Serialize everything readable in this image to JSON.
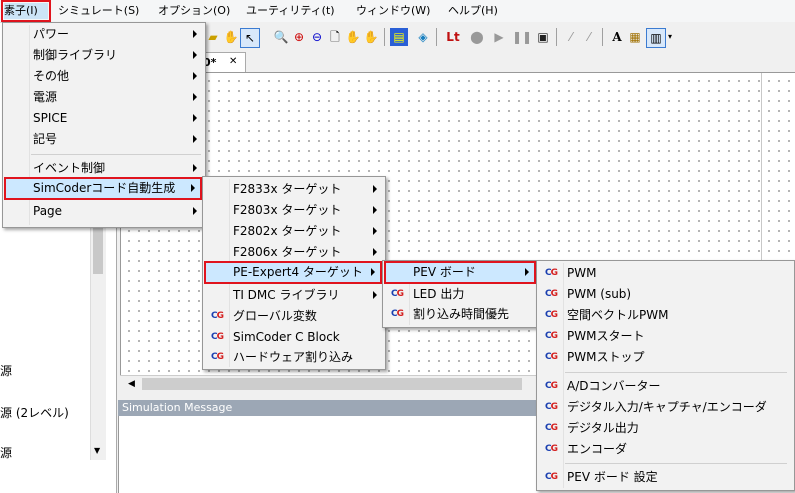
{
  "menubar": [
    "素子(I)",
    "シミュレート(S)",
    "オプション(O)",
    "ユーティリティ(t)",
    "ウィンドウ(W)",
    "ヘルプ(H)"
  ],
  "toolbar": {
    "lt_label": "Lt",
    "text_tool": "A"
  },
  "tab": {
    "label": "0*",
    "close": "✕"
  },
  "left_panel": [
    "源",
    "源 (2レベル)",
    "源"
  ],
  "sim_message": {
    "title": "Simulation Message"
  },
  "menu1": {
    "items": [
      {
        "label": "パワー"
      },
      {
        "label": "制御ライブラリ"
      },
      {
        "label": "その他"
      },
      {
        "label": "電源"
      },
      {
        "label": "SPICE"
      },
      {
        "label": "記号"
      },
      {
        "label": "イベント制御"
      },
      {
        "label": "SimCoderコード自動生成"
      },
      {
        "label": "Page"
      }
    ]
  },
  "menu2": {
    "items": [
      {
        "label": "F2833x ターゲット"
      },
      {
        "label": "F2803x ターゲット"
      },
      {
        "label": "F2802x ターゲット"
      },
      {
        "label": "F2806x ターゲット"
      },
      {
        "label": "PE-Expert4 ターゲット"
      },
      {
        "label": "TI DMC ライブラリ"
      },
      {
        "label": "グローバル変数"
      },
      {
        "label": "SimCoder C Block"
      },
      {
        "label": "ハードウェア割り込み"
      }
    ]
  },
  "menu3": {
    "items": [
      {
        "label": "PEV ボード"
      },
      {
        "label": "LED 出力"
      },
      {
        "label": "割り込み時間優先"
      }
    ]
  },
  "menu4": {
    "items": [
      {
        "label": "PWM"
      },
      {
        "label": "PWM (sub)"
      },
      {
        "label": "空間ベクトルPWM"
      },
      {
        "label": "PWMスタート"
      },
      {
        "label": "PWMストップ"
      },
      {
        "label": "A/Dコンバーター"
      },
      {
        "label": "デジタル入力/キャプチャ/エンコーダ"
      },
      {
        "label": "デジタル出力"
      },
      {
        "label": "エンコーダ"
      },
      {
        "label": "PEV ボード 設定"
      }
    ]
  },
  "icon_text": {
    "cg_c": "C",
    "cg_g": "G"
  }
}
